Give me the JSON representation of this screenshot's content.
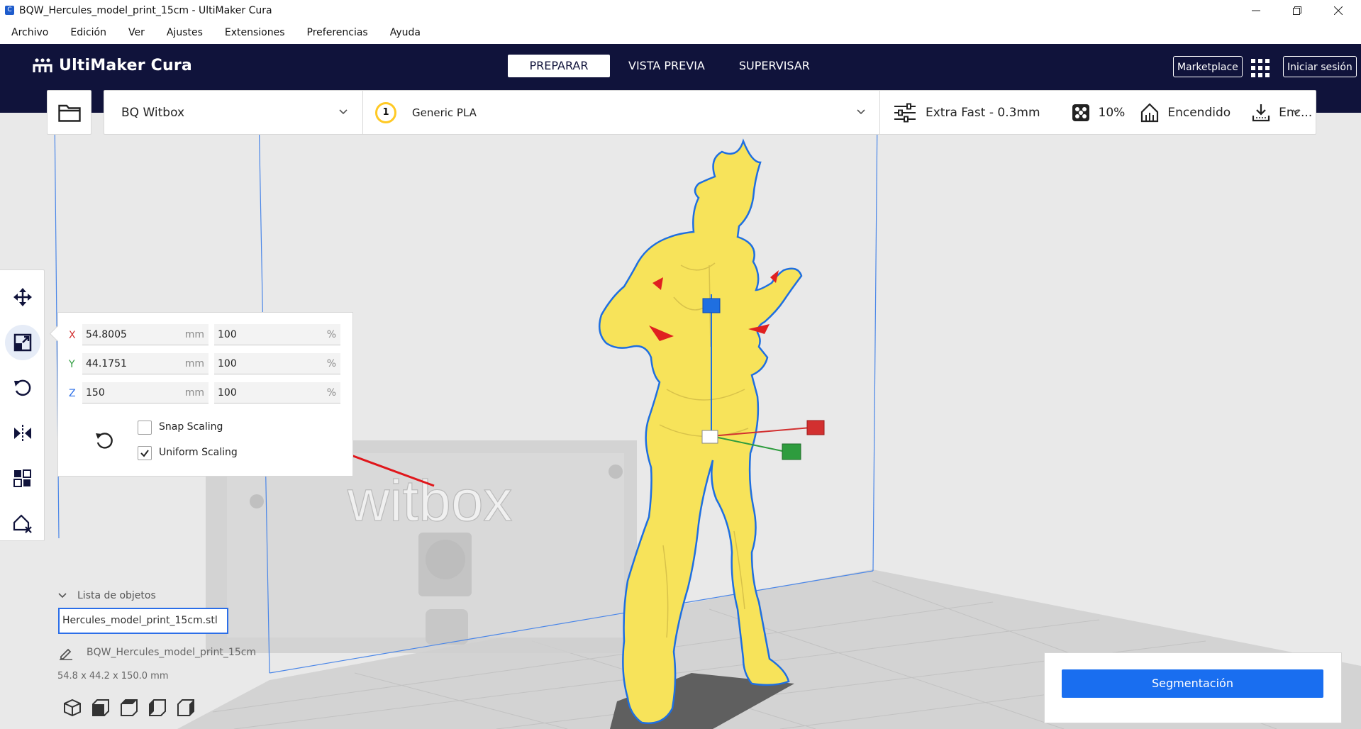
{
  "window": {
    "title": "BQW_Hercules_model_print_15cm - UltiMaker Cura",
    "app_icon": "C"
  },
  "menu": [
    "Archivo",
    "Edición",
    "Ver",
    "Ajustes",
    "Extensiones",
    "Preferencias",
    "Ayuda"
  ],
  "header": {
    "logo_text": "UltiMaker Cura",
    "stages": [
      {
        "label": "PREPARAR",
        "active": true
      },
      {
        "label": "VISTA PREVIA",
        "active": false
      },
      {
        "label": "SUPERVISAR",
        "active": false
      }
    ],
    "marketplace_label": "Marketplace",
    "signin_label": "Iniciar sesión"
  },
  "printer": {
    "machine": "BQ Witbox",
    "extruder_number": "1",
    "material": "Generic PLA",
    "profile": "Extra Fast - 0.3mm",
    "infill": "10%",
    "support": "Encendido",
    "adhesion": "Enc..."
  },
  "scale_panel": {
    "x": {
      "label": "X",
      "mm": "54.8005",
      "pct": "100",
      "color": "#d23030"
    },
    "y": {
      "label": "Y",
      "mm": "44.1751",
      "pct": "100",
      "color": "#2e9c3e"
    },
    "z": {
      "label": "Z",
      "mm": "150",
      "pct": "100",
      "color": "#2b6ee8"
    },
    "mm_unit": "mm",
    "pct_unit": "%",
    "snap_scaling": {
      "label": "Snap Scaling",
      "checked": false
    },
    "uniform_scaling": {
      "label": "Uniform Scaling",
      "checked": true
    }
  },
  "scene": {
    "build_plate_logo": "witbox"
  },
  "object_list": {
    "header": "Lista de objetos",
    "selected_object": "Hercules_model_print_15cm.stl",
    "job_name": "BQW_Hercules_model_print_15cm",
    "dimensions": "54.8 x 44.2 x 150.0 mm"
  },
  "slice_button": "Segmentación",
  "colors": {
    "header_bg": "#10133b",
    "accent": "#196ef0",
    "model_yellow": "#f7e35a",
    "material_badge": "#ffc924"
  }
}
